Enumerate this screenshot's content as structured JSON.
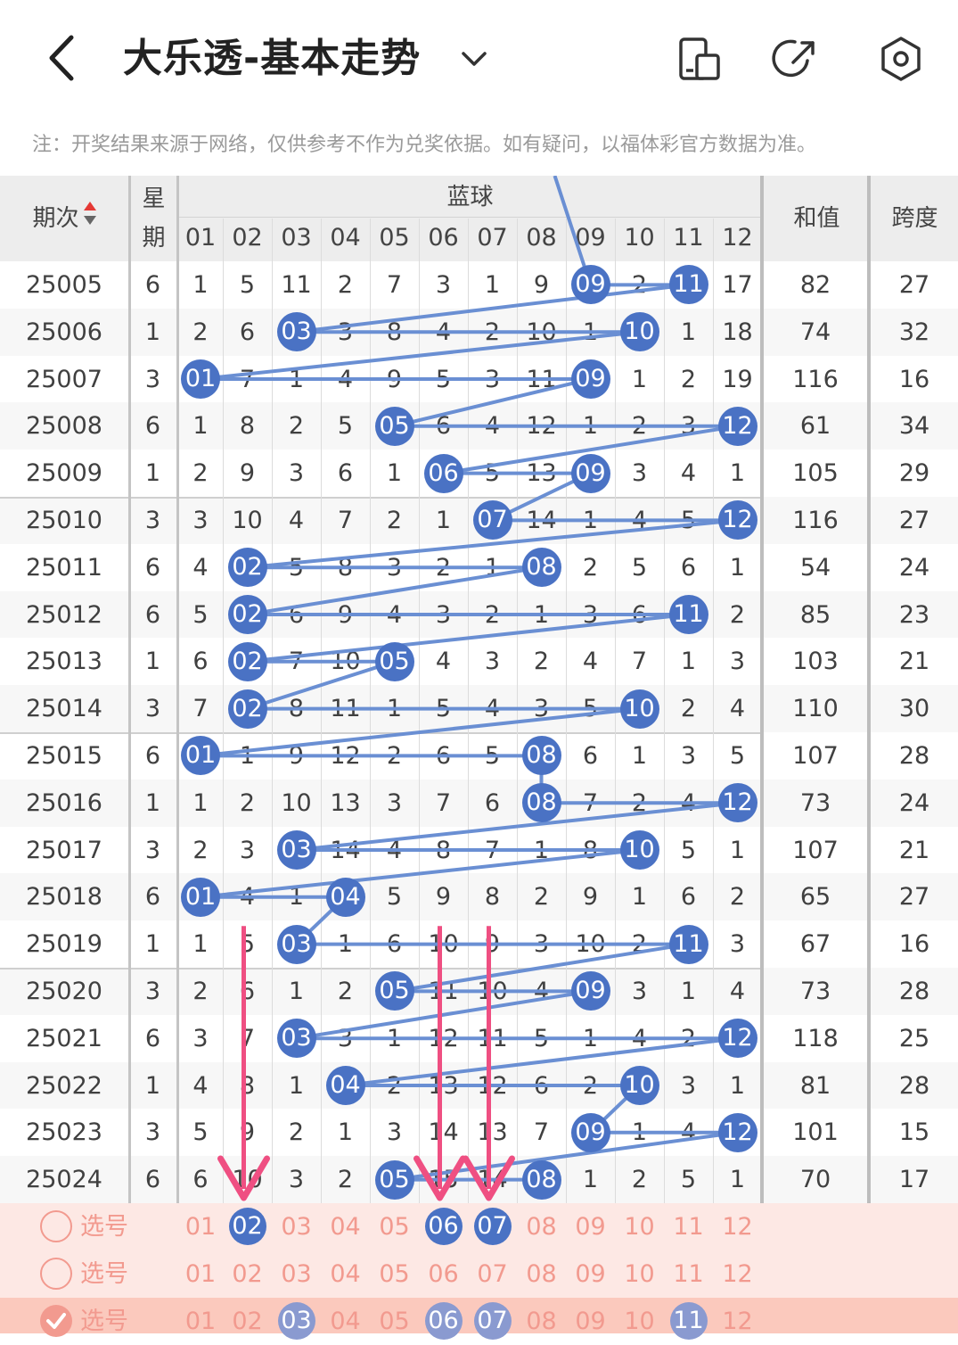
{
  "header": {
    "title": "大乐透-基本走势",
    "back_icon": "back-arrow-icon",
    "dropdown_icon": "chevron-down-icon",
    "actions": [
      {
        "name": "rotate-screen-icon"
      },
      {
        "name": "share-icon"
      },
      {
        "name": "settings-icon"
      }
    ]
  },
  "notice": "注：开奖结果来源于网络，仅供参考不作为兑奖依据。如有疑问，以福体彩官方数据为准。",
  "columns": {
    "period": "期次",
    "weekday_top": "星",
    "weekday_bottom": "期",
    "group": "蓝球",
    "numbers": [
      "01",
      "02",
      "03",
      "04",
      "05",
      "06",
      "07",
      "08",
      "09",
      "10",
      "11",
      "12"
    ],
    "sum": "和值",
    "span": "跨度"
  },
  "colors": {
    "ball": "#4a72c4",
    "line": "#6a8fd3",
    "header_bg": "#ededed",
    "alt_row_bg": "#f7f7f7",
    "select_bg": "#fde8e4",
    "select_checked_bg": "#fbc9bd",
    "select_text": "#f29a8f",
    "arrow": "#ef4f82"
  },
  "rows": [
    {
      "period": "25005",
      "weekday": "6",
      "cells": [
        "1",
        "5",
        "11",
        "2",
        "7",
        "3",
        "1",
        "9",
        "09",
        "2",
        "11",
        "17"
      ],
      "sum": "82",
      "span": "27",
      "balls": [
        9,
        11
      ]
    },
    {
      "period": "25006",
      "weekday": "1",
      "cells": [
        "2",
        "6",
        "03",
        "3",
        "8",
        "4",
        "2",
        "10",
        "1",
        "10",
        "1",
        "18"
      ],
      "sum": "74",
      "span": "32",
      "balls": [
        3,
        10
      ]
    },
    {
      "period": "25007",
      "weekday": "3",
      "cells": [
        "01",
        "7",
        "1",
        "4",
        "9",
        "5",
        "3",
        "11",
        "09",
        "1",
        "2",
        "19"
      ],
      "sum": "116",
      "span": "16",
      "balls": [
        1,
        9
      ]
    },
    {
      "period": "25008",
      "weekday": "6",
      "cells": [
        "1",
        "8",
        "2",
        "5",
        "05",
        "6",
        "4",
        "12",
        "1",
        "2",
        "3",
        "12"
      ],
      "sum": "61",
      "span": "34",
      "balls": [
        5,
        12
      ]
    },
    {
      "period": "25009",
      "weekday": "1",
      "cells": [
        "2",
        "9",
        "3",
        "6",
        "1",
        "06",
        "5",
        "13",
        "09",
        "3",
        "4",
        "1"
      ],
      "sum": "105",
      "span": "29",
      "balls": [
        6,
        9
      ]
    },
    {
      "period": "25010",
      "weekday": "3",
      "cells": [
        "3",
        "10",
        "4",
        "7",
        "2",
        "1",
        "07",
        "14",
        "1",
        "4",
        "5",
        "12"
      ],
      "sum": "116",
      "span": "27",
      "balls": [
        7,
        12
      ]
    },
    {
      "period": "25011",
      "weekday": "6",
      "cells": [
        "4",
        "02",
        "5",
        "8",
        "3",
        "2",
        "1",
        "08",
        "2",
        "5",
        "6",
        "1"
      ],
      "sum": "54",
      "span": "24",
      "balls": [
        2,
        8
      ]
    },
    {
      "period": "25012",
      "weekday": "6",
      "cells": [
        "5",
        "02",
        "6",
        "9",
        "4",
        "3",
        "2",
        "1",
        "3",
        "6",
        "11",
        "2"
      ],
      "sum": "85",
      "span": "23",
      "balls": [
        2,
        11
      ]
    },
    {
      "period": "25013",
      "weekday": "1",
      "cells": [
        "6",
        "02",
        "7",
        "10",
        "05",
        "4",
        "3",
        "2",
        "4",
        "7",
        "1",
        "3"
      ],
      "sum": "103",
      "span": "21",
      "balls": [
        2,
        5
      ]
    },
    {
      "period": "25014",
      "weekday": "3",
      "cells": [
        "7",
        "02",
        "8",
        "11",
        "1",
        "5",
        "4",
        "3",
        "5",
        "10",
        "2",
        "4"
      ],
      "sum": "110",
      "span": "30",
      "balls": [
        2,
        10
      ]
    },
    {
      "period": "25015",
      "weekday": "6",
      "cells": [
        "01",
        "1",
        "9",
        "12",
        "2",
        "6",
        "5",
        "08",
        "6",
        "1",
        "3",
        "5"
      ],
      "sum": "107",
      "span": "28",
      "balls": [
        1,
        8
      ]
    },
    {
      "period": "25016",
      "weekday": "1",
      "cells": [
        "1",
        "2",
        "10",
        "13",
        "3",
        "7",
        "6",
        "08",
        "7",
        "2",
        "4",
        "12"
      ],
      "sum": "73",
      "span": "24",
      "balls": [
        8,
        12
      ]
    },
    {
      "period": "25017",
      "weekday": "3",
      "cells": [
        "2",
        "3",
        "03",
        "14",
        "4",
        "8",
        "7",
        "1",
        "8",
        "10",
        "5",
        "1"
      ],
      "sum": "107",
      "span": "21",
      "balls": [
        3,
        10
      ]
    },
    {
      "period": "25018",
      "weekday": "6",
      "cells": [
        "01",
        "4",
        "1",
        "04",
        "5",
        "9",
        "8",
        "2",
        "9",
        "1",
        "6",
        "2"
      ],
      "sum": "65",
      "span": "27",
      "balls": [
        1,
        4
      ]
    },
    {
      "period": "25019",
      "weekday": "1",
      "cells": [
        "1",
        "5",
        "03",
        "1",
        "6",
        "10",
        "9",
        "3",
        "10",
        "2",
        "11",
        "3"
      ],
      "sum": "67",
      "span": "16",
      "balls": [
        3,
        11
      ]
    },
    {
      "period": "25020",
      "weekday": "3",
      "cells": [
        "2",
        "6",
        "1",
        "2",
        "05",
        "11",
        "10",
        "4",
        "09",
        "3",
        "1",
        "4"
      ],
      "sum": "73",
      "span": "28",
      "balls": [
        5,
        9
      ]
    },
    {
      "period": "25021",
      "weekday": "6",
      "cells": [
        "3",
        "7",
        "03",
        "3",
        "1",
        "12",
        "11",
        "5",
        "1",
        "4",
        "2",
        "12"
      ],
      "sum": "118",
      "span": "25",
      "balls": [
        3,
        12
      ]
    },
    {
      "period": "25022",
      "weekday": "1",
      "cells": [
        "4",
        "8",
        "1",
        "04",
        "2",
        "13",
        "12",
        "6",
        "2",
        "10",
        "3",
        "1"
      ],
      "sum": "81",
      "span": "28",
      "balls": [
        4,
        10
      ]
    },
    {
      "period": "25023",
      "weekday": "3",
      "cells": [
        "5",
        "9",
        "2",
        "1",
        "3",
        "14",
        "13",
        "7",
        "09",
        "1",
        "4",
        "12"
      ],
      "sum": "101",
      "span": "15",
      "balls": [
        9,
        12
      ]
    },
    {
      "period": "25024",
      "weekday": "6",
      "cells": [
        "6",
        "10",
        "3",
        "2",
        "05",
        "15",
        "14",
        "08",
        "1",
        "2",
        "5",
        "1"
      ],
      "sum": "70",
      "span": "17",
      "balls": [
        5,
        8
      ]
    }
  ],
  "select_rows": [
    {
      "label": "选号",
      "checked": false,
      "numbers": [
        "01",
        "02",
        "03",
        "04",
        "05",
        "06",
        "07",
        "08",
        "09",
        "10",
        "11",
        "12"
      ],
      "selected": [
        2,
        6,
        7
      ]
    },
    {
      "label": "选号",
      "checked": false,
      "numbers": [
        "01",
        "02",
        "03",
        "04",
        "05",
        "06",
        "07",
        "08",
        "09",
        "10",
        "11",
        "12"
      ],
      "selected": []
    },
    {
      "label": "选号",
      "checked": true,
      "numbers": [
        "01",
        "02",
        "03",
        "04",
        "05",
        "06",
        "07",
        "08",
        "09",
        "10",
        "11",
        "12"
      ],
      "selected": [
        3,
        6,
        7,
        11
      ]
    }
  ],
  "annotation_arrow_columns": [
    2,
    6,
    7
  ]
}
